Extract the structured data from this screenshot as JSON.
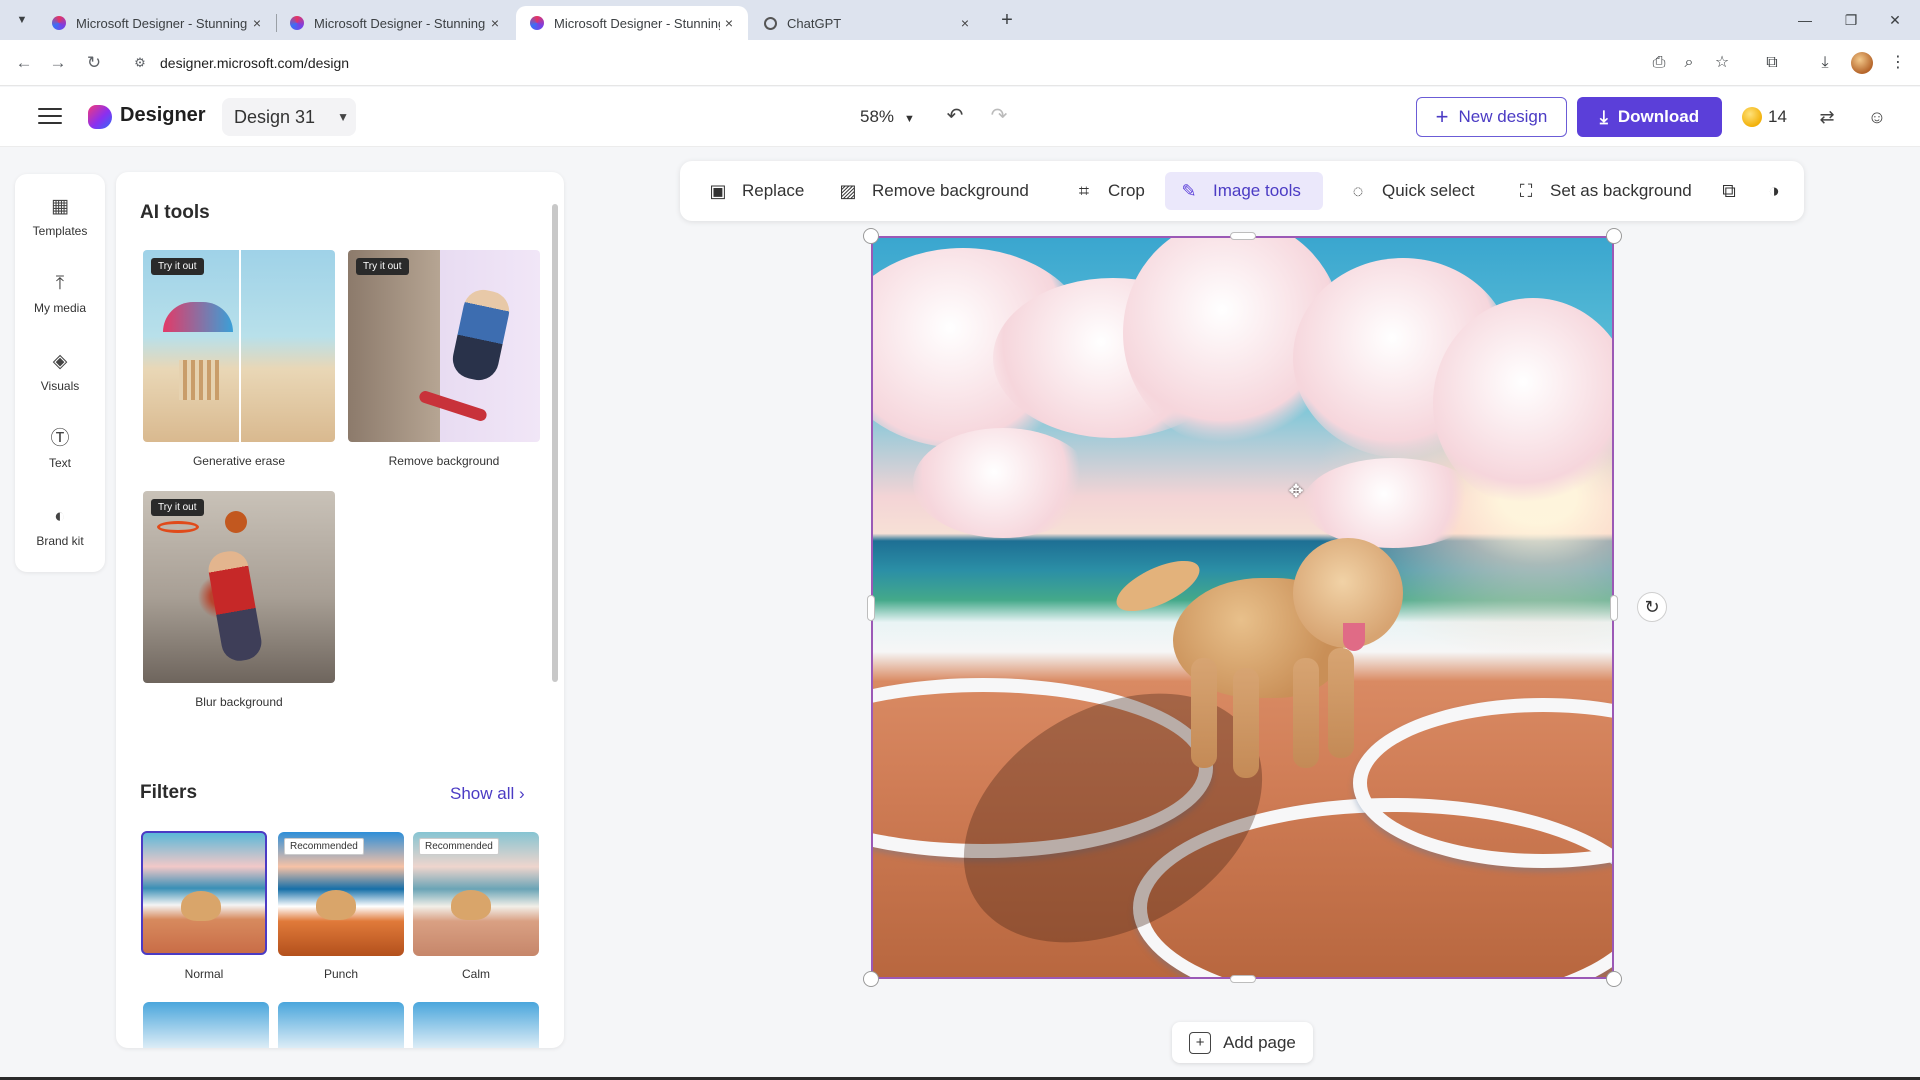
{
  "browser": {
    "tabs": [
      {
        "title": "Microsoft Designer - Stunning",
        "active": false
      },
      {
        "title": "Microsoft Designer - Stunning",
        "active": false
      },
      {
        "title": "Microsoft Designer - Stunning",
        "active": true
      },
      {
        "title": "ChatGPT",
        "active": false
      }
    ],
    "close_glyph": "×",
    "new_tab_glyph": "+",
    "url": "designer.microsoft.com/design"
  },
  "app": {
    "brand": "Designer",
    "design_name": "Design 31",
    "zoom": "58%",
    "new_design_label": "New design",
    "download_label": "Download",
    "credits": "14",
    "accent_color": "#5b3fd9"
  },
  "rail": {
    "items": [
      {
        "label": "Templates",
        "icon": "templates-icon"
      },
      {
        "label": "My media",
        "icon": "upload-icon"
      },
      {
        "label": "Visuals",
        "icon": "visuals-icon"
      },
      {
        "label": "Text",
        "icon": "text-icon"
      },
      {
        "label": "Brand kit",
        "icon": "palette-icon"
      }
    ]
  },
  "panel": {
    "ai_tools_title": "AI tools",
    "try_badge": "Try it out",
    "ai_tools": [
      {
        "label": "Generative erase"
      },
      {
        "label": "Remove background"
      },
      {
        "label": "Blur background"
      }
    ],
    "filters_title": "Filters",
    "show_all": "Show all",
    "recommended_badge": "Recommended",
    "filters": [
      {
        "label": "Normal",
        "selected": true
      },
      {
        "label": "Punch",
        "selected": false
      },
      {
        "label": "Calm",
        "selected": false
      }
    ]
  },
  "toolbar": {
    "items": [
      {
        "label": "Replace",
        "icon": "replace-image-icon"
      },
      {
        "label": "Remove background",
        "icon": "remove-background-icon"
      },
      {
        "label": "Crop",
        "icon": "crop-icon"
      },
      {
        "label": "Image tools",
        "icon": "image-tools-icon",
        "active": true
      },
      {
        "label": "Quick select",
        "icon": "quick-select-icon"
      },
      {
        "label": "Set as background",
        "icon": "set-background-icon"
      }
    ]
  },
  "canvas": {
    "add_page_label": "Add page"
  }
}
